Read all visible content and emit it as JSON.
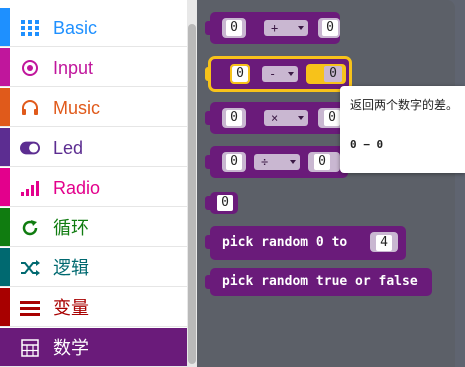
{
  "toolbox": {
    "categories": [
      {
        "label": "Basic",
        "color": "#1e90ff",
        "icon": "grid-icon"
      },
      {
        "label": "Input",
        "color": "#c0169c",
        "icon": "target-icon"
      },
      {
        "label": "Music",
        "color": "#e05a1b",
        "icon": "headphones-icon"
      },
      {
        "label": "Led",
        "color": "#5c2d91",
        "icon": "toggle-icon"
      },
      {
        "label": "Radio",
        "color": "#e3008c",
        "icon": "signal-bars-icon"
      },
      {
        "label": "循环",
        "color": "#107c10",
        "icon": "loop-icon"
      },
      {
        "label": "逻辑",
        "color": "#006970",
        "icon": "shuffle-icon"
      },
      {
        "label": "变量",
        "color": "#a80000",
        "icon": "list-icon"
      },
      {
        "label": "数学",
        "color": "#6a1b7a",
        "icon": "calculator-icon"
      }
    ]
  },
  "blocks": {
    "add": {
      "left": "0",
      "op": "+",
      "right": "0"
    },
    "subtract": {
      "left": "0",
      "op": "-",
      "right": "0"
    },
    "multiply": {
      "left": "0",
      "op": "×",
      "right": "0"
    },
    "divide": {
      "left": "0",
      "op": "÷",
      "right": "0"
    },
    "number": {
      "value": "0"
    },
    "random": {
      "text": "pick random 0 to",
      "max": "4"
    },
    "random_bool": {
      "text": "pick random true or false"
    }
  },
  "tooltip": {
    "text": "返回两个数字的差。",
    "signature": "0 − 0"
  },
  "colors": {
    "math": "#6a1b7a",
    "highlight": "#f7c21a",
    "flyout": "#5c6068"
  }
}
